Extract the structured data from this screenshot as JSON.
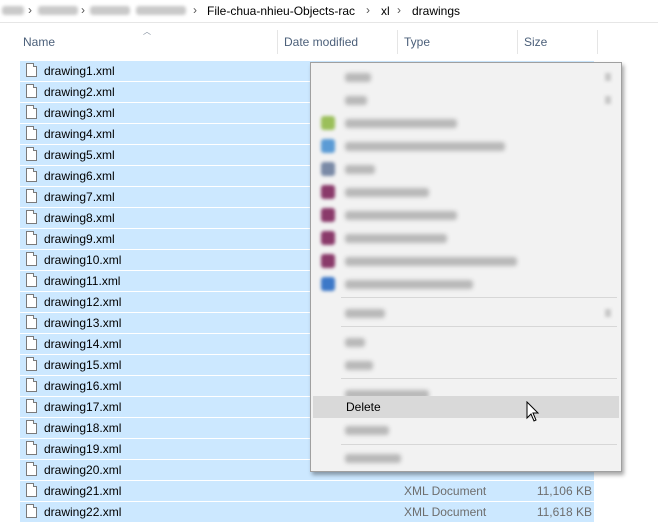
{
  "breadcrumb": {
    "items": [
      "File-chua-nhieu-Objects-rac",
      "xl",
      "drawings"
    ]
  },
  "columns": {
    "name": "Name",
    "date_modified": "Date modified",
    "type": "Type",
    "size": "Size"
  },
  "files": [
    {
      "name": "drawing1.xml",
      "type": "",
      "size": ""
    },
    {
      "name": "drawing2.xml",
      "type": "",
      "size": ""
    },
    {
      "name": "drawing3.xml",
      "type": "",
      "size": ""
    },
    {
      "name": "drawing4.xml",
      "type": "",
      "size": ""
    },
    {
      "name": "drawing5.xml",
      "type": "",
      "size": ""
    },
    {
      "name": "drawing6.xml",
      "type": "",
      "size": ""
    },
    {
      "name": "drawing7.xml",
      "type": "",
      "size": ""
    },
    {
      "name": "drawing8.xml",
      "type": "",
      "size": ""
    },
    {
      "name": "drawing9.xml",
      "type": "",
      "size": ""
    },
    {
      "name": "drawing10.xml",
      "type": "",
      "size": ""
    },
    {
      "name": "drawing11.xml",
      "type": "",
      "size": ""
    },
    {
      "name": "drawing12.xml",
      "type": "",
      "size": ""
    },
    {
      "name": "drawing13.xml",
      "type": "",
      "size": ""
    },
    {
      "name": "drawing14.xml",
      "type": "",
      "size": ""
    },
    {
      "name": "drawing15.xml",
      "type": "",
      "size": ""
    },
    {
      "name": "drawing16.xml",
      "type": "",
      "size": ""
    },
    {
      "name": "drawing17.xml",
      "type": "",
      "size": ""
    },
    {
      "name": "drawing18.xml",
      "type": "",
      "size": ""
    },
    {
      "name": "drawing19.xml",
      "type": "",
      "size": ""
    },
    {
      "name": "drawing20.xml",
      "type": "",
      "size": ""
    },
    {
      "name": "drawing21.xml",
      "type": "XML Document",
      "size": "11,106 KB"
    },
    {
      "name": "drawing22.xml",
      "type": "XML Document",
      "size": "11,618 KB"
    }
  ],
  "context_menu": {
    "highlighted_item": "Delete"
  },
  "colors": {
    "selection": "#cce8ff",
    "menu_background": "#f2f2f2",
    "menu_highlight": "#d9d9d9",
    "header_text": "#4c607a"
  }
}
